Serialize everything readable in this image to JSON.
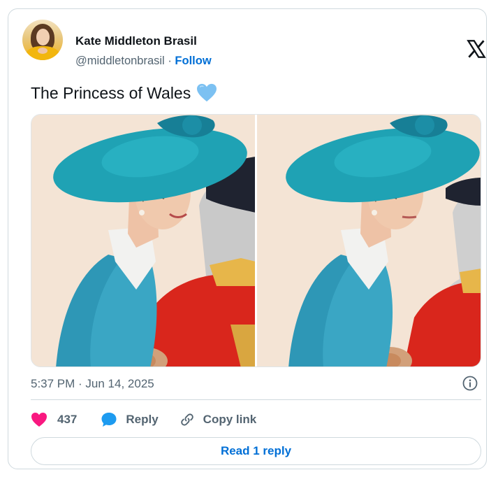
{
  "author": {
    "name": "Kate Middleton Brasil",
    "handle": "@middletonbrasil",
    "separator": "·",
    "follow_label": "Follow"
  },
  "tweet": {
    "text": "The Princess of Wales",
    "emoji": "blue-heart-icon",
    "timestamp": "5:37 PM · Jun 14, 2025"
  },
  "media": {
    "images": [
      {
        "name": "photo-smiling",
        "description_icon": "photo"
      },
      {
        "name": "photo-neutral",
        "description_icon": "photo"
      }
    ]
  },
  "actions": {
    "likes": "437",
    "reply_label": "Reply",
    "copy_label": "Copy link"
  },
  "read_replies_label": "Read 1 reply",
  "colors": {
    "link": "#006fd6",
    "like": "#f91880",
    "reply_icon": "#1d9bf0",
    "muted": "#536471",
    "border": "#cfd9de"
  }
}
